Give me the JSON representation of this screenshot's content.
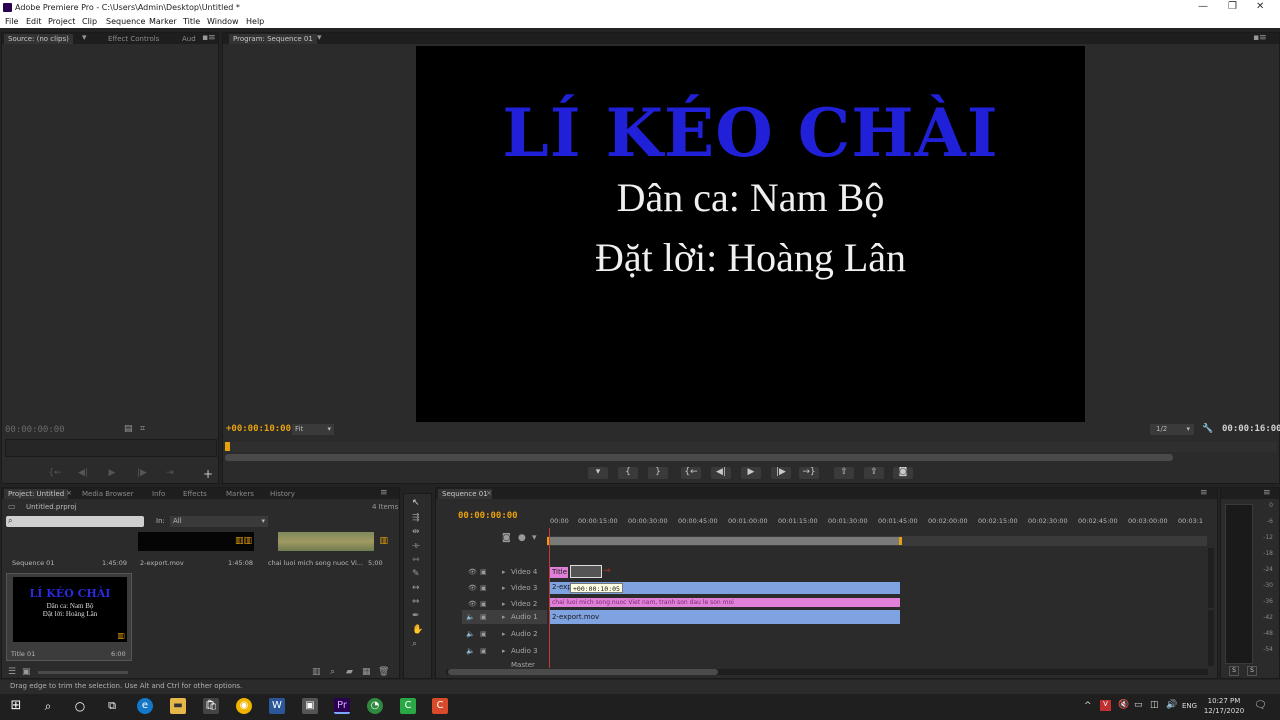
{
  "window": {
    "title": "Adobe Premiere Pro - C:\\Users\\Admin\\Desktop\\Untitled *",
    "controls": [
      "—",
      "❐",
      "✕"
    ]
  },
  "menu": [
    "File",
    "Edit",
    "Project",
    "Clip",
    "Sequence",
    "Marker",
    "Title",
    "Window",
    "Help"
  ],
  "source_panel": {
    "tabs": [
      "Source: (no clips)",
      "Effect Controls",
      "Aud"
    ],
    "timecode": "00:00:00:00"
  },
  "program_panel": {
    "tab": "Program: Sequence 01",
    "timecode_left": "+00:00:10:00",
    "fit": "Fit",
    "quality": "1/2",
    "timecode_right": "00:00:16:00",
    "frame": {
      "title": "LÍ KÉO CHÀI",
      "line2": "Dân ca: Nam Bộ",
      "line3": "Đặt lời: Hoàng Lân"
    }
  },
  "project_panel": {
    "tabs": [
      "Project: Untitled",
      "Media Browser",
      "Info",
      "Effects",
      "Markers",
      "History"
    ],
    "file": "Untitled.prproj",
    "items_count": "4 Items",
    "in_label": "In:",
    "in_value": "All",
    "items": [
      {
        "name": "Sequence 01",
        "duration": "1:45:09"
      },
      {
        "name": "2-export.mov",
        "duration": "1:45:08"
      },
      {
        "name": "chai luoi mich song nuoc Vi...",
        "duration": "5;00"
      },
      {
        "name": "Title 01",
        "duration": "6:00"
      }
    ],
    "thumb_title": {
      "title": "LÍ KÉO CHÀI",
      "line2": "Dân ca: Nam Bộ",
      "line3": "Đặt lời: Hoàng Lân"
    }
  },
  "timeline": {
    "tab": "Sequence 01",
    "timecode": "00:00:00:00",
    "ruler": [
      "00:00",
      "00:00:15:00",
      "00:00:30:00",
      "00:00:45:00",
      "00:01:00:00",
      "00:01:15:00",
      "00:01:30:00",
      "00:01:45:00",
      "00:02:00:00",
      "00:02:15:00",
      "00:02:30:00",
      "00:02:45:00",
      "00:03:00:00",
      "00:03:1"
    ],
    "tracks": [
      "Video 4",
      "Video 3",
      "Video 2",
      "Audio 1",
      "Audio 2",
      "Audio 3",
      "Master"
    ],
    "clips": {
      "title": "Title",
      "video3": "2-exp",
      "video2": "chai luoi mich song nuoc Viet nam, tranh son dau le son moi",
      "audio1": "2-export.mov"
    },
    "tooltip": "+00:00:10:05"
  },
  "meter_scale": [
    "0",
    "-6",
    "-12",
    "-18",
    "-24",
    "-30",
    "-36",
    "-42",
    "-48",
    "-54"
  ],
  "status_bar": "Drag edge to trim the selection. Use Alt and Ctrl for other options.",
  "taskbar": {
    "lang": "ENG",
    "time": "10:27 PM",
    "date": "12/17/2020"
  },
  "colors": {
    "accent_orange": "#e8a10e",
    "title_blue": "#2020d8",
    "clip_blue": "#7fa2e0",
    "clip_pink": "#e080d8"
  }
}
